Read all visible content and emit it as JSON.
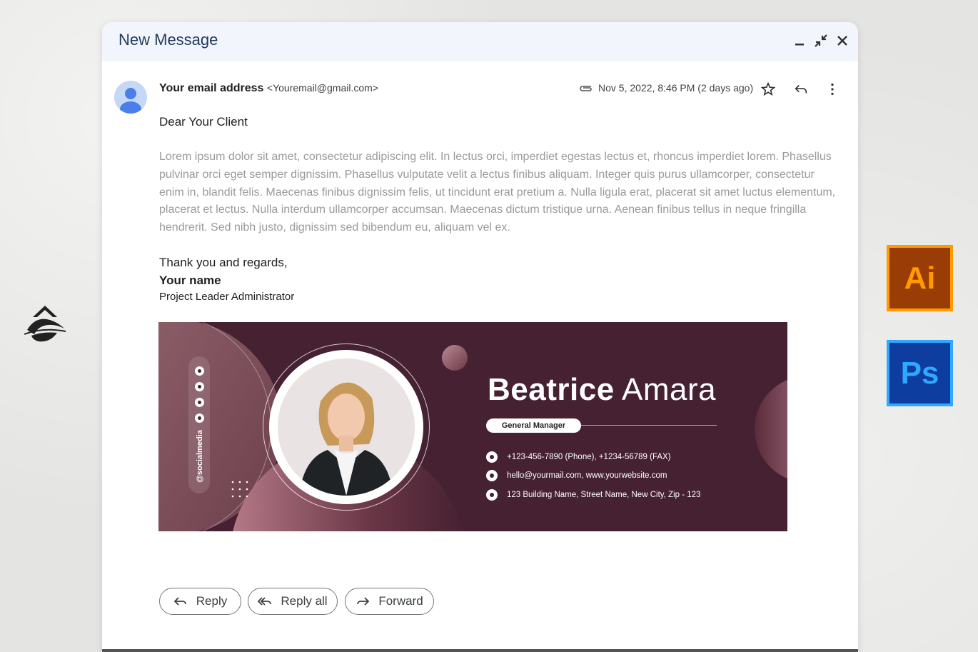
{
  "window": {
    "title": "New Message",
    "minimize_icon": "minimize-icon",
    "collapse_icon": "collapse-icon",
    "close_icon": "close-icon"
  },
  "email": {
    "sender_name": "Your email address",
    "sender_address": "<Youremail@gmail.com>",
    "date": "Nov 5, 2022, 8:46 PM (2 days ago)",
    "greeting": "Dear Your Client",
    "body": "Lorem ipsum dolor sit amet, consectetur adipiscing elit. In lectus orci, imperdiet egestas lectus et, rhoncus imperdiet lorem. Phasellus pulvinar orci eget semper dignissim. Phasellus vulputate velit a lectus finibus aliquam. Integer quis purus ullamcorper, consectetur enim in, blandit felis. Maecenas finibus dignissim felis, ut tincidunt erat pretium a. Nulla ligula erat, placerat sit amet luctus elementum, placerat et lectus. Nulla interdum ullamcorper accumsan. Maecenas dictum tristique urna. Aenean finibus tellus in neque fringilla hendrerit. Sed nibh justo, dignissim sed bibendum eu, aliquam vel ex.",
    "closing": "Thank you and regards,",
    "signature_name": "Your name",
    "signature_title": "Project Leader Administrator"
  },
  "banner": {
    "first_name": "Beatrice",
    "last_name": "Amara",
    "role": "General Manager",
    "social_handle": "@socialmedia",
    "phone": "+123-456-7890 (Phone), +1234-56789 (FAX)",
    "email_web": "hello@yourmail.com, www.yourwebsite.com",
    "address": "123 Building Name, Street Name, New City, Zip - 123",
    "colors": {
      "background": "#452131",
      "accent": "#8a5c66"
    }
  },
  "actions": {
    "reply": "Reply",
    "reply_all": "Reply all",
    "forward": "Forward"
  },
  "badges": {
    "ai": "Ai",
    "ps": "Ps"
  }
}
